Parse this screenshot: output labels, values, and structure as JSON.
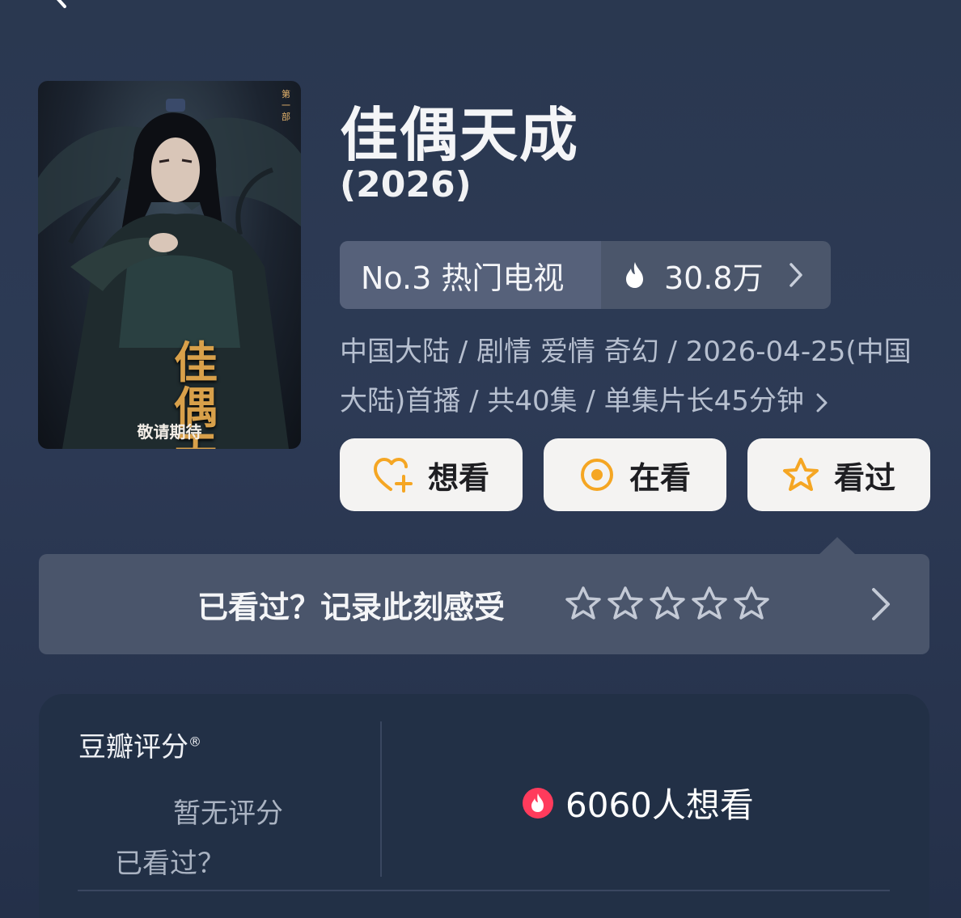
{
  "header": {
    "back_icon": "chevron-left-icon"
  },
  "poster": {
    "title_text": "佳偶天成",
    "tagline": "敬请期待",
    "side_text": "第一部"
  },
  "show": {
    "title": "佳偶天成",
    "year": "(2026)"
  },
  "ranking": {
    "rank_label": "No.3 热门电视",
    "heat_value": "30.8万",
    "heat_icon": "flame-icon"
  },
  "meta": {
    "line": "中国大陆 / 剧情 爱情 奇幻 / 2026-04-25(中国大陆)首播 / 共40集 / 单集片长45分钟"
  },
  "actions": {
    "want_label": "想看",
    "watching_label": "在看",
    "watched_label": "看过",
    "accent_color": "#f5a623"
  },
  "record": {
    "prompt": "已看过？记录此刻感受",
    "star_count": 5
  },
  "douban": {
    "title": "豆瓣评分",
    "registered_mark": "®",
    "no_rating": "暂无评分",
    "watched_prompt": "已看过？",
    "want_count": "6060人想看",
    "want_icon_color": "#ff3b5c"
  }
}
